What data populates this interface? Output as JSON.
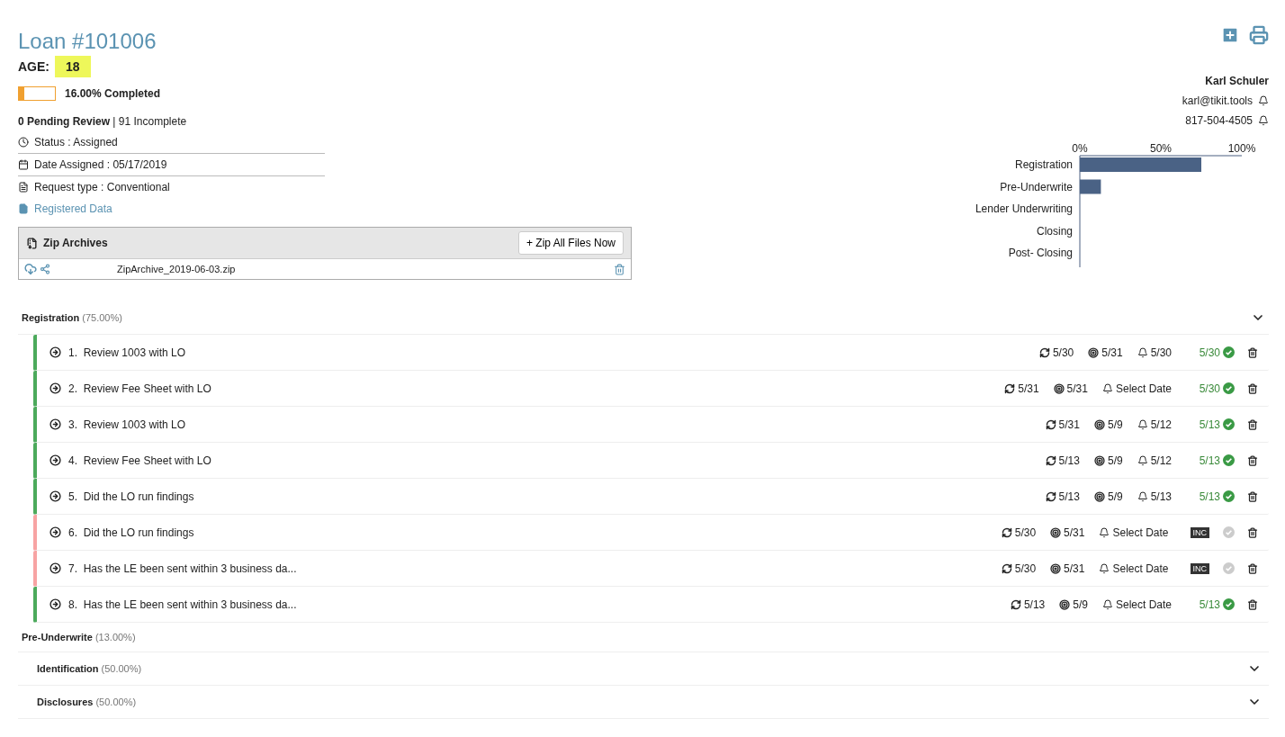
{
  "loan": {
    "title": "Loan #101006",
    "age_label": "AGE:",
    "age": "18",
    "progress": {
      "level": 0.16,
      "label": "16.00% Completed"
    },
    "pending": "**0 Pending Review** | 91 Incomplete",
    "details": [
      {
        "kind": "status",
        "text": "Status : Assigned"
      },
      {
        "kind": "date",
        "text": "Date Assigned : 05/17/2019"
      },
      {
        "kind": "request",
        "text": "Request type : Conventional"
      }
    ],
    "registered_link": "Registered Data"
  },
  "zip_archives": {
    "title": "Zip Archives",
    "button": "+ Zip All Files Now",
    "files": [
      "ZipArchive_2019-06-03.zip"
    ]
  },
  "contact": {
    "name": "Karl Schuler",
    "email": "karl@tikit.tools",
    "phone": "817-504-4505"
  },
  "progress_chart": {
    "chart_data": {
      "type": "bar",
      "orientation": "horizontal",
      "categories": [
        "Registration",
        "Pre-Underwrite",
        "Lender Underwriting",
        "Closing",
        "Post- Closing"
      ],
      "values": [
        75,
        13,
        0,
        0,
        0
      ],
      "xlim": [
        0,
        100
      ],
      "xticks": [
        {
          "value": 0,
          "label": "0%"
        },
        {
          "value": 50,
          "label": "50%"
        },
        {
          "value": 100,
          "label": "100%"
        }
      ]
    }
  },
  "sections": [
    {
      "name": "Registration",
      "percent": "(75.00%)",
      "collapsible": true,
      "tasks": [
        {
          "number": "1.",
          "title": "Review 1003 with LO",
          "recur": "5/30",
          "target": "5/31",
          "reminder": "5/30",
          "done": "5/30",
          "complete": true
        },
        {
          "number": "2.",
          "title": "Review Fee Sheet with LO",
          "recur": "5/31",
          "target": "5/31",
          "reminder": "Select Date",
          "done": "5/30",
          "complete": true
        },
        {
          "number": "3.",
          "title": "Review 1003 with LO",
          "recur": "5/31",
          "target": "5/9",
          "reminder": "5/12",
          "done": "5/13",
          "complete": true
        },
        {
          "number": "4.",
          "title": "Review Fee Sheet with LO",
          "recur": "5/13",
          "target": "5/9",
          "reminder": "5/12",
          "done": "5/13",
          "complete": true
        },
        {
          "number": "5.",
          "title": "Did the LO run findings",
          "recur": "5/13",
          "target": "5/9",
          "reminder": "5/13",
          "done": "5/13",
          "complete": true
        },
        {
          "number": "6.",
          "title": "Did the LO run findings",
          "recur": "5/30",
          "target": "5/31",
          "reminder": "Select Date",
          "done": "INC",
          "complete": false
        },
        {
          "number": "7.",
          "title": "Has the LE been sent within 3 business da...",
          "recur": "5/30",
          "target": "5/31",
          "reminder": "Select Date",
          "done": "INC",
          "complete": false
        },
        {
          "number": "8.",
          "title": "Has the LE been sent within 3 business da...",
          "recur": "5/13",
          "target": "5/9",
          "reminder": "Select Date",
          "done": "5/13",
          "complete": true
        }
      ]
    },
    {
      "name": "Pre-Underwrite",
      "percent": "(13.00%)",
      "collapsible": false,
      "children": [
        {
          "name": "Identification",
          "percent": "(50.00%)",
          "collapsible": true
        },
        {
          "name": "Disclosures",
          "percent": "(50.00%)",
          "collapsible": true
        }
      ]
    }
  ]
}
